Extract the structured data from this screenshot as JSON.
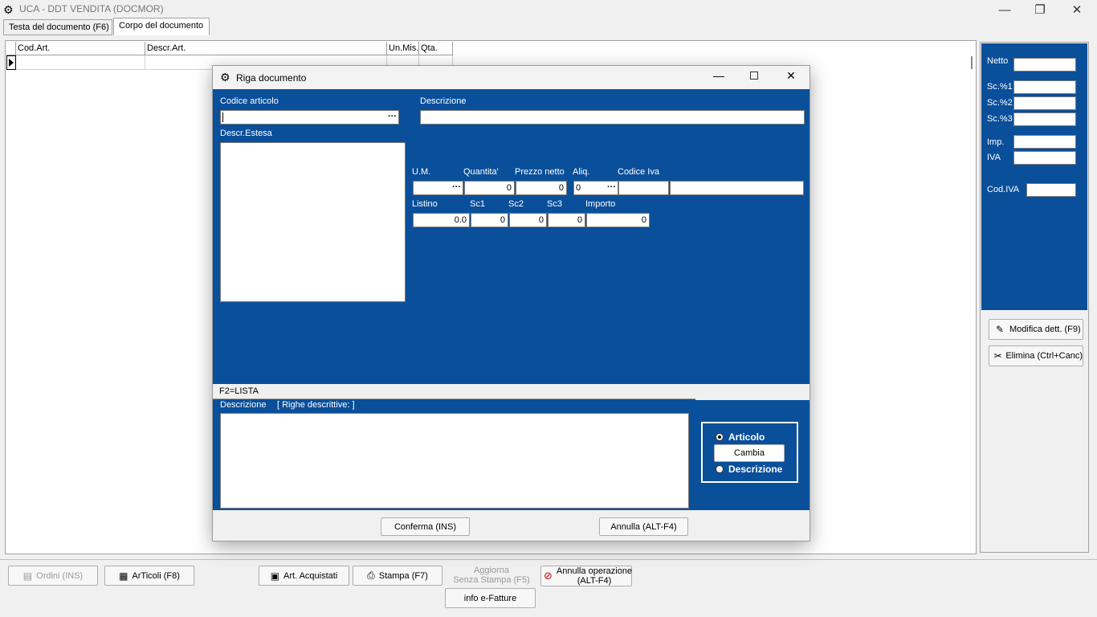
{
  "window": {
    "title": "UCA - DDT VENDITA (DOCMOR)",
    "minimize_glyph": "—",
    "restore_glyph": "❐",
    "close_glyph": "✕"
  },
  "tabs": [
    {
      "label": "Testa del documento (F6)"
    },
    {
      "label": "Corpo del documento"
    }
  ],
  "grid": {
    "columns": [
      "Cod.Art.",
      "Descr.Art.",
      "Un.Mis.",
      "Qta."
    ]
  },
  "right_panel": {
    "netto": "Netto",
    "sc1": "Sc.%1",
    "sc2": "Sc.%2",
    "sc3": "Sc.%3",
    "imp": "Imp.",
    "iva": "IVA",
    "cod_iva": "Cod.IVA",
    "modifica_button": "Modifica dett. (F9)",
    "elimina_button": "Elimina  (Ctrl+Canc)"
  },
  "dialog": {
    "title": "Riga documento",
    "codice_articolo_label": "Codice articolo",
    "descrizione_label": "Descrizione",
    "descr_estesa_label": "Descr.Estesa",
    "um_label": "U.M.",
    "quantita_label": "Quantita'",
    "prezzo_netto_label": "Prezzo netto",
    "aliq_label": "Aliq.",
    "codice_iva_label": "Codice Iva",
    "quantita_value": "0",
    "prezzo_netto_value": "0",
    "aliq_value": "0",
    "listino_label": "Listino",
    "sc1_label": "Sc1",
    "sc2_label": "Sc2",
    "sc3_label": "Sc3",
    "importo_label": "Importo",
    "listino_value": "0.0",
    "sc1_value": "0",
    "sc2_value": "0",
    "sc3_value": "0",
    "importo_value": "0",
    "f2_hint": "F2=LISTA",
    "descrizione2_label": "Descrizione",
    "righe_descrittive_label": "[ Righe descrittive: ]",
    "radio_articolo": "Articolo",
    "cambia_button": "Cambia",
    "radio_descrizione": "Descrizione",
    "conferma_button": "Conferma  (INS)",
    "annulla_button": "Annulla  (ALT-F4)",
    "ellipsis": "···"
  },
  "bottom": {
    "ordini": "Ordini (INS)",
    "articoli": "ArTicoli (F8)",
    "art_acquistati": "Art. Acquistati",
    "stampa": "Stampa  (F7)",
    "aggiorna_line1": "Aggiorna",
    "aggiorna_line2": "Senza Stampa  (F5)",
    "annulla_line1": "Annulla operazione",
    "annulla_line2": "(ALT-F4)",
    "info_efatture": "info e-Fatture"
  },
  "colors": {
    "dialog_blue": "#0a4f9a"
  }
}
